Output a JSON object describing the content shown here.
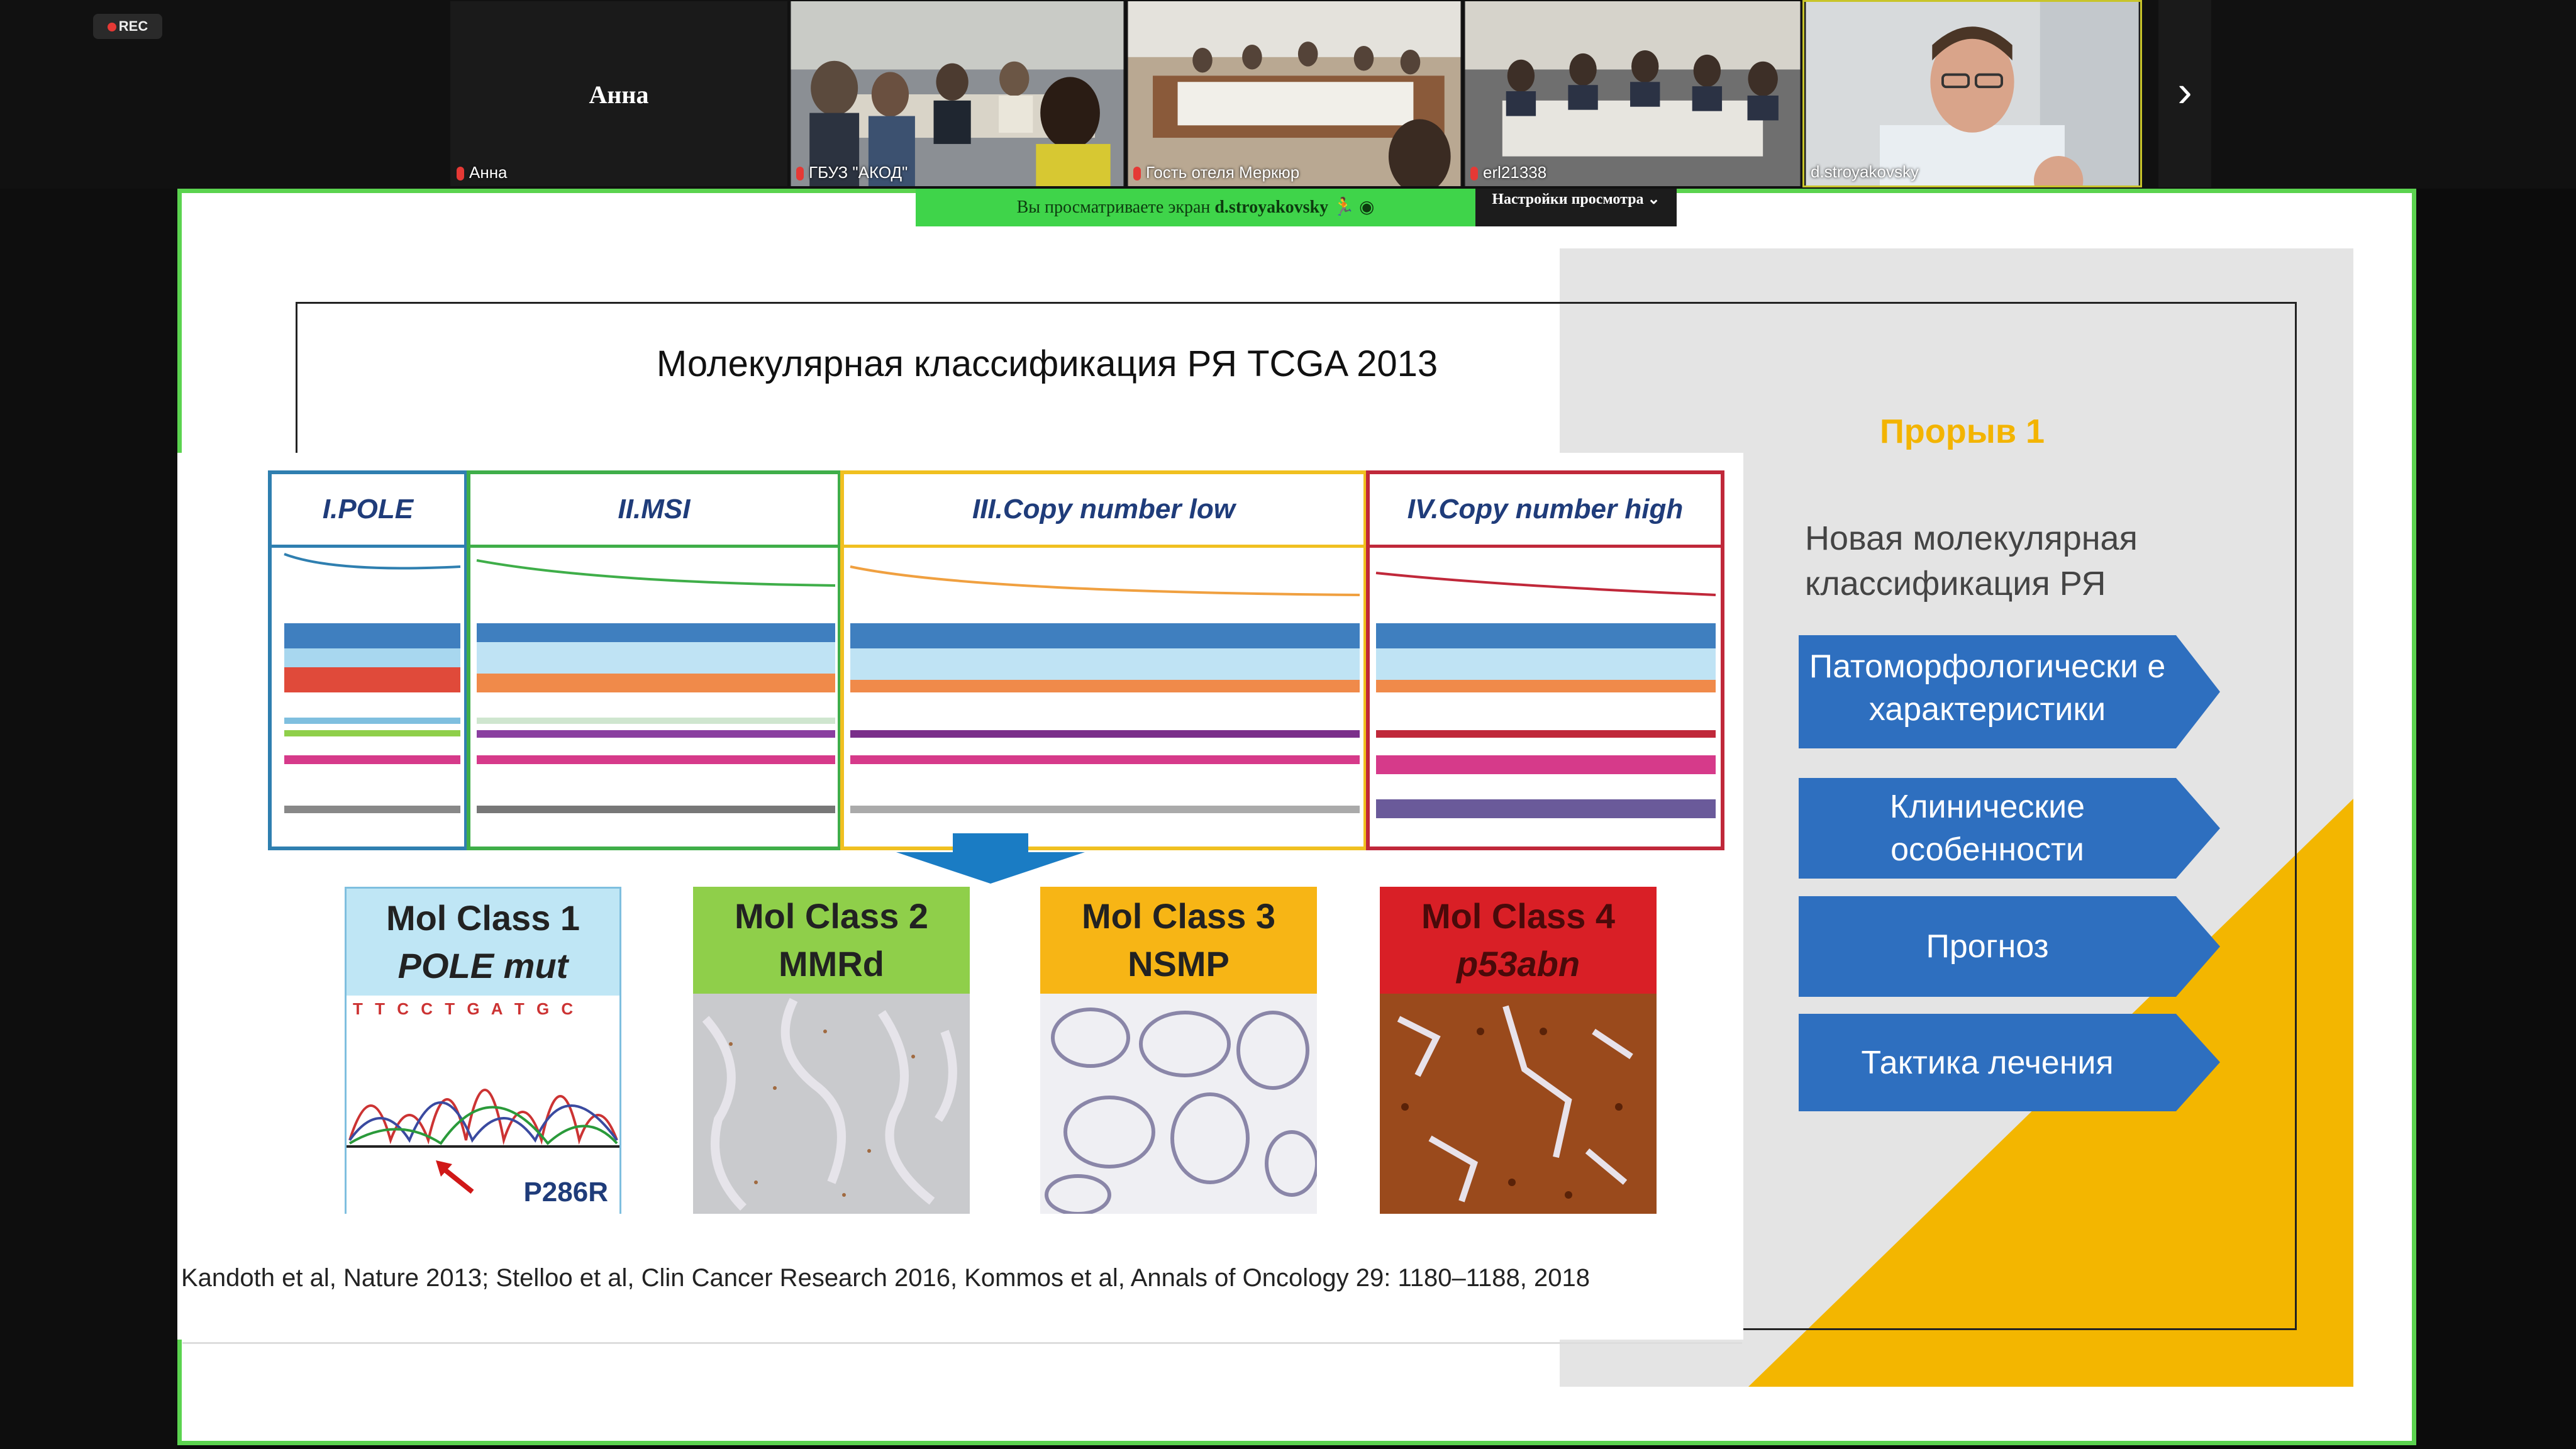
{
  "window": {
    "rec_label": "REC",
    "participants": [
      {
        "name": "Анна",
        "display": "Анна",
        "muted": true
      },
      {
        "name": "ГБУЗ \"АКОД\"",
        "muted": true
      },
      {
        "name": "Гость отеля Меркюр",
        "muted": true
      },
      {
        "name": "erl21338",
        "muted": true
      },
      {
        "name": "d.stroyakovsky",
        "muted": false
      }
    ],
    "next_icon": "chevron-right-icon",
    "share_banner": "Вы просматриваете экран",
    "share_presenter": "d.stroyakovsky",
    "view_settings": "Настройки просмотра"
  },
  "slide": {
    "title": "Молекулярная классификация РЯ TCGA 2013",
    "breakthrough": "Прорыв 1",
    "subtitle": "Новая молекулярная классификация РЯ",
    "chevrons": [
      "Патоморфологически е характеристики",
      "Клинические особенности",
      "Прогноз",
      "Тактика лечения"
    ],
    "tcga_groups": [
      {
        "label": "I.POLE",
        "color": "#2f7fb0"
      },
      {
        "label": "II.MSI",
        "color": "#3fae49"
      },
      {
        "label": "III.Copy number low",
        "color": "#f0c020"
      },
      {
        "label": "IV.Copy number high",
        "color": "#c0283a"
      }
    ],
    "mol_classes": [
      {
        "line1": "Mol Class 1",
        "line2": "POLE mut",
        "color": "#bfe6f5",
        "note": "P286R",
        "seq": "T T C C T G A T G C"
      },
      {
        "line1": "Mol Class 2",
        "line2": "MMRd",
        "color": "#8fcf4a"
      },
      {
        "line1": "Mol Class 3",
        "line2": "NSMP",
        "color": "#f7b515"
      },
      {
        "line1": "Mol Class 4",
        "line2": "p53abn",
        "color": "#d91f26"
      }
    ],
    "references": "Kandoth et al, Nature 2013; Stelloo et al, Clin Cancer Research 2016,  Kommos et al, Annals of Oncology 29: 1180–1188, 2018",
    "colors": {
      "accent_blue": "#2e6fbf",
      "accent_yellow": "#f3b400",
      "frame_green": "#5bd34f"
    }
  }
}
